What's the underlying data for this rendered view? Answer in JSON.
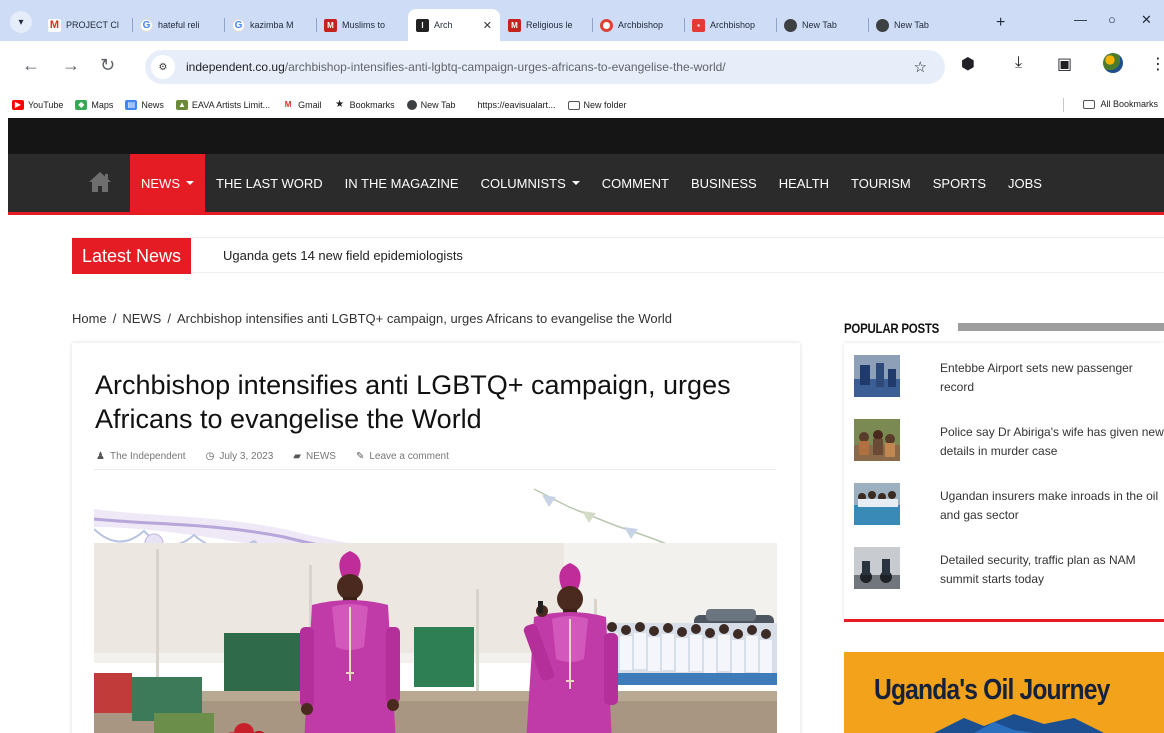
{
  "browser": {
    "tabs": [
      {
        "title": "PROJECT Cl",
        "icon": "gmail-icon"
      },
      {
        "title": "hateful reli",
        "icon": "google-icon"
      },
      {
        "title": "kazimba M",
        "icon": "google-icon"
      },
      {
        "title": "Muslims to",
        "icon": "monitor-icon"
      },
      {
        "title": "Arch",
        "icon": "independent-icon",
        "active": true
      },
      {
        "title": "Religious le",
        "icon": "monitor-icon"
      },
      {
        "title": "Archbishop",
        "icon": "chrome-icon"
      },
      {
        "title": "Archbishop",
        "icon": "red-news-icon"
      },
      {
        "title": "New Tab",
        "icon": "newtab-icon"
      },
      {
        "title": "New Tab",
        "icon": "newtab-icon"
      }
    ],
    "url_host": "independent.co.ug",
    "url_path": "/archbishop-intensifies-anti-lgbtq-campaign-urges-africans-to-evangelise-the-world/",
    "bookmarks": [
      {
        "label": "YouTube",
        "icon": "youtube-icon"
      },
      {
        "label": "Maps",
        "icon": "maps-icon"
      },
      {
        "label": "News",
        "icon": "news-icon"
      },
      {
        "label": "EAVA Artists Limit...",
        "icon": "eava-icon"
      },
      {
        "label": "Gmail",
        "icon": "gmail-icon"
      },
      {
        "label": "Bookmarks",
        "icon": "star-icon"
      },
      {
        "label": "New Tab",
        "icon": "newtab-icon"
      },
      {
        "label": "https://eavisualart...",
        "icon": ""
      },
      {
        "label": "New folder",
        "icon": "folder-icon"
      }
    ],
    "all_bookmarks": "All Bookmarks"
  },
  "site": {
    "nav": [
      {
        "label": "NEWS",
        "active": true,
        "dropdown": true
      },
      {
        "label": "THE LAST WORD"
      },
      {
        "label": "IN THE MAGAZINE"
      },
      {
        "label": "COLUMNISTS",
        "dropdown": true
      },
      {
        "label": "COMMENT"
      },
      {
        "label": "BUSINESS"
      },
      {
        "label": "HEALTH"
      },
      {
        "label": "TOURISM"
      },
      {
        "label": "SPORTS"
      },
      {
        "label": "JOBS"
      }
    ],
    "latest_label": "Latest News",
    "latest_headline": "Uganda gets 14 new field epidemiologists",
    "breadcrumb": {
      "home": "Home",
      "section": "NEWS",
      "current": "Archbishop intensifies anti LGBTQ+ campaign, urges Africans to evangelise the World"
    },
    "article": {
      "title": "Archbishop intensifies anti LGBTQ+ campaign, urges Africans to evangelise the World",
      "author": "The Independent",
      "date": "July 3, 2023",
      "category": "NEWS",
      "comment_link": "Leave a comment"
    },
    "popular": {
      "heading": "POPULAR POSTS",
      "items": [
        "Entebbe Airport sets new passenger record",
        "Police say Dr Abiriga's wife has given new details in murder case",
        "Ugandan insurers make inroads in the oil and gas sector",
        "Detailed security, traffic plan as NAM summit starts today"
      ]
    },
    "ad_text": "Uganda's Oil Journey"
  },
  "colors": {
    "accent_red": "#e51c23",
    "nav_bg": "#2b2b2b",
    "ad_orange": "#f2a21b",
    "tabstrip": "#cfdcf6"
  }
}
